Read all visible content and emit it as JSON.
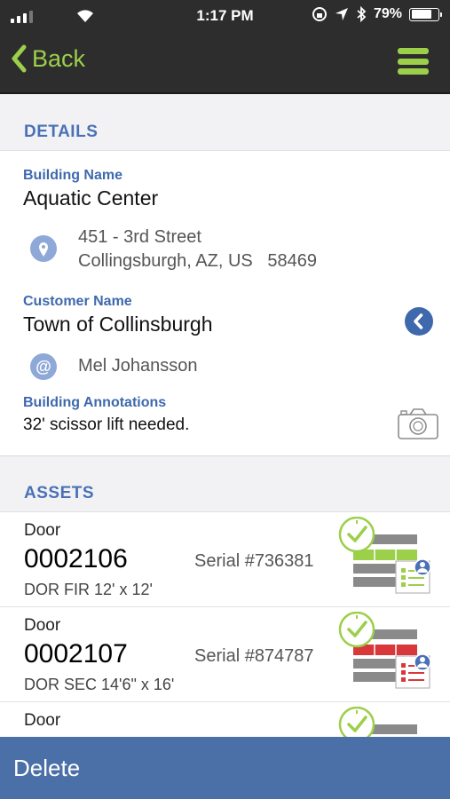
{
  "status": {
    "time": "1:17 PM",
    "battery": "79%",
    "battery_level": 0.79
  },
  "nav": {
    "back_label": "Back"
  },
  "details": {
    "header": "DETAILS",
    "building_name_label": "Building Name",
    "building_name": "Aquatic Center",
    "address_line1": "451 - 3rd Street",
    "address_line2": "Collingsburgh, AZ, US   58469",
    "customer_name_label": "Customer Name",
    "customer_name": "Town of Collinsburgh",
    "contact_name": "Mel Johansson",
    "annotations_label": "Building Annotations",
    "annotations": "32' scissor lift needed."
  },
  "assets": {
    "header": "ASSETS",
    "items": [
      {
        "type": "Door",
        "number": "0002106",
        "serial": "Serial #736381",
        "desc": "DOR FIR 12' x 12'",
        "status_color": "#9ccf4a"
      },
      {
        "type": "Door",
        "number": "0002107",
        "serial": "Serial #874787",
        "desc": "DOR SEC 14'6\" x 16'",
        "status_color": "#d9383a"
      },
      {
        "type": "Door",
        "number": "",
        "serial": "",
        "desc": "",
        "status_color": "#9ccf4a"
      }
    ]
  },
  "footer": {
    "delete_label": "Delete"
  },
  "colors": {
    "accent_green": "#9ccf4a",
    "link_blue": "#4a71b6",
    "footer_blue": "#4b6fa7"
  }
}
